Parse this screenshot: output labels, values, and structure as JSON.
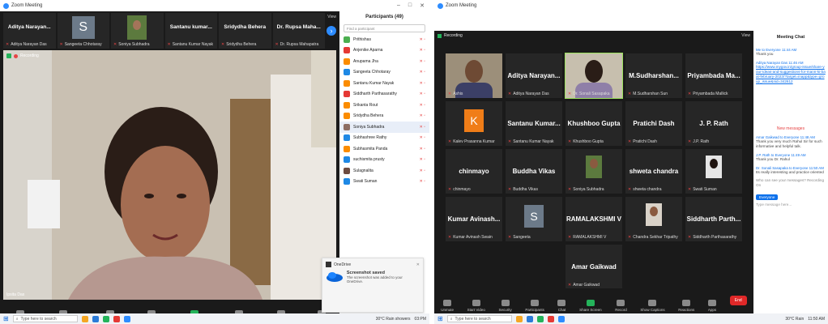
{
  "left": {
    "window_title": "Zoom Meeting",
    "top_strip": [
      {
        "big": "Aditya Narayan...",
        "small": "Aditya Narayan Das"
      },
      {
        "big": "S",
        "small": "Sangeeta Chhotaray"
      },
      {
        "big": "",
        "small": "Soniya Subhadra"
      },
      {
        "big": "Santanu kumar...",
        "small": "Santanu Kumar Nayak"
      },
      {
        "big": "Sridydha Behera",
        "small": "Sridydha Behera"
      },
      {
        "big": "Dr. Rupsa Maha...",
        "small": "Dr. Rupsa Mahapatra"
      }
    ],
    "view_label": "View",
    "recording_label": "Recording",
    "speaker_label": "Ipsita Das",
    "participants": {
      "title": "Participants (49)",
      "search_placeholder": "Find a participant",
      "items": [
        {
          "name": "Prithishas",
          "color": "#4caf50"
        },
        {
          "name": "Anjenike Aparna",
          "color": "#e53935"
        },
        {
          "name": "Anupama Jha",
          "color": "#fb8c00"
        },
        {
          "name": "Sangeeta Chhotaray",
          "color": "#1e88e5"
        },
        {
          "name": "Santanu Kumar Nayak",
          "color": "#fb8c00"
        },
        {
          "name": "Siddharth Parthasarathy",
          "color": "#e53935"
        },
        {
          "name": "Srikanta Rout",
          "color": "#fb8c00"
        },
        {
          "name": "Sridydha Behera",
          "color": "#fb8c00"
        },
        {
          "name": "Soniya Subhadra",
          "color": "#8d6e63"
        },
        {
          "name": "Subhashree Rathy",
          "color": "#1e88e5"
        },
        {
          "name": "Subhasmita Panda",
          "color": "#fb8c00"
        },
        {
          "name": "suchismita prusty",
          "color": "#1e88e5"
        },
        {
          "name": "Sulagnalita",
          "color": "#6d4c41"
        },
        {
          "name": "Swati Suman",
          "color": "#1e88e5"
        }
      ]
    },
    "toast": {
      "app": "OneDrive",
      "title": "Screenshot saved",
      "body": "The screenshot was added to your OneDrive."
    },
    "toolbar": [
      "Unmute",
      "Start Video",
      "Participants",
      "Chat",
      "Share Screen",
      "Record",
      "Reactions",
      "Apps"
    ],
    "taskbar": {
      "search": "Type here to search",
      "weather": "30°C Rain showers",
      "time": "03:PM",
      "date": ""
    }
  },
  "right": {
    "window_title": "Zoom Meeting",
    "view_label": "View",
    "recording_label": "Recording",
    "tiles": [
      {
        "name": "Ashis",
        "big": "",
        "kind": "video"
      },
      {
        "name": "Aditya Narayan Das",
        "big": "Aditya Narayan...",
        "kind": "name"
      },
      {
        "name": "Dr. Sonali Sasapaka",
        "big": "",
        "kind": "video2"
      },
      {
        "name": "M.Sudharshan Sun",
        "big": "M.Sudharshan...",
        "kind": "name"
      },
      {
        "name": "Priyambada Mallick",
        "big": "Priyambada Ma...",
        "kind": "name"
      },
      {
        "name": "Kalev Prasanna Kumar",
        "big": "K",
        "kind": "letter"
      },
      {
        "name": "Santanu Kumar Nayak",
        "big": "Santanu Kumar...",
        "kind": "name"
      },
      {
        "name": "Khushboo Gupta",
        "big": "Khushboo Gupta",
        "kind": "name"
      },
      {
        "name": "Pratichi Dash",
        "big": "Pratichi Dash",
        "kind": "name"
      },
      {
        "name": "J.P. Rath",
        "big": "J. P. Rath",
        "kind": "name"
      },
      {
        "name": "chinmayo",
        "big": "chinmayo",
        "kind": "name"
      },
      {
        "name": "Buddha Vikas",
        "big": "Buddha Vikas",
        "kind": "name"
      },
      {
        "name": "Soniya Subhadra",
        "big": "",
        "kind": "photo"
      },
      {
        "name": "shweta chandra",
        "big": "shweta chandra",
        "kind": "name"
      },
      {
        "name": "Swati Suman",
        "big": "",
        "kind": "photo2"
      },
      {
        "name": "Kumar Avinash Swain",
        "big": "Kumar Avinash...",
        "kind": "name"
      },
      {
        "name": "Sangeeta",
        "big": "S",
        "kind": "letter2"
      },
      {
        "name": "RAMALAKSHMI V",
        "big": "RAMALAKSHMI V",
        "kind": "name"
      },
      {
        "name": "Chandra Sekhar Tripathy",
        "big": "",
        "kind": "photo3"
      },
      {
        "name": "Siddharth Parthasarathy",
        "big": "Siddharth Parth...",
        "kind": "name"
      },
      {
        "name": "Amar Gaikwad",
        "big": "Amar Gaikwad",
        "kind": "name"
      }
    ],
    "chat": {
      "title": "Meeting Chat",
      "m1_from": "Me to Everyone 11:44 AM",
      "m1_text": "Thank you",
      "m2_from": "Aditya Narayan Das 11:46 AM",
      "m2_link": "https://www.mygov.in/group-issue/share-your-ideas-and-suggestions-for-mann-ki-baat-february-2023/?target=inapp&type=group_issue&nid=342612",
      "new_messages": "New messages",
      "m3_from": "Amar Gaikwad to Everyone 11:48 AM",
      "m3_text": "Thank you very much Rahul Sir for such informative and helpful talk.",
      "m4_from": "J.P. Rath to Everyone 11:49 AM",
      "m4_text": "Thank you Dr. Rahul",
      "m5_from": "Dr. Sonali Sasapaka to Everyone 11:50 AM",
      "m5_text": "Its really interesting and practice oriented",
      "m6_text": "Who can see your messages? Recording On",
      "to_label": "Everyone",
      "input_placeholder": "Type message here..."
    },
    "toolbar": [
      "Unmute",
      "Start Video",
      "Security",
      "Participants",
      "Chat",
      "Share Screen",
      "Record",
      "Show Captions",
      "Reactions",
      "Apps"
    ],
    "end_label": "End",
    "taskbar": {
      "search": "Type here to search",
      "weather": "30°C Rain",
      "time": "11:50 AM",
      "date": ""
    }
  },
  "colors": {
    "zoom_blue": "#2d8cff",
    "muted_red": "#e64545",
    "share_green": "#24b35a",
    "end_red": "#e02828"
  }
}
